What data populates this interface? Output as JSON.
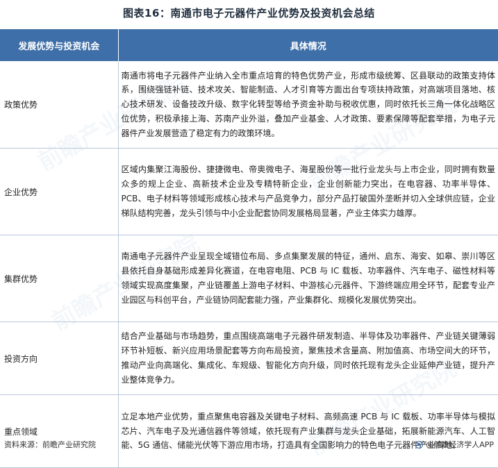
{
  "title": "图表16：南通市电子元器件产业优势及投资机会总结",
  "table": {
    "headers": [
      "发展优势与投资机会",
      "具体情况"
    ],
    "rows": [
      {
        "label": "政策优势",
        "text": "南通市将电子元器件产业纳入全市重点培育的特色优势产业，形成市级统筹、区县联动的政策支持体系，围绕强链补链、技术攻关、智能制造、人才引育等方面出台专项扶持政策，对高端项目落地、核心技术研发、设备技改升级、数字化转型等给予资金补助与税收优惠，同时依托长三角一体化战略区位优势，积极承接上海、苏南产业外溢，叠加产业基金、人才政策、要素保障等配套举措，为电子元器件产业发展营造了稳定有力的政策环境。"
      },
      {
        "label": "企业优势",
        "text": "区域内集聚江海股份、捷捷微电、帝奥微电子、海星股份等一批行业龙头与上市企业，同时拥有数量众多的规上企业、高新技术企业及专精特新企业，企业创新能力突出，在电容器、功率半导体、PCB、电子材料等领域形成核心技术与产品竞争力，部分产品打破国外垄断并切入全球供应链，企业梯队结构完善，龙头引领与中小企业配套协同发展格局显著，产业主体实力雄厚。"
      },
      {
        "label": "集群优势",
        "text": "南通电子元器件产业呈现全域错位布局、多点集聚发展的特征，通州、启东、海安、如皋、崇川等区县依托自身基础形成差异化赛道，在电容电阻、PCB 与 IC 载板、功率器件、汽车电子、磁性材料等领域实现高度集聚，产业链覆盖上游电子材料、中游核心元器件、下游终端应用全环节，配套专业产业园区与科创平台，产业链协同配套能力强，产业集群化、规模化发展优势突出。"
      },
      {
        "label": "投资方向",
        "text": "结合产业基础与市场趋势，重点围绕高端电子元器件研发制造、半导体及功率器件、产业链关键薄弱环节补短板、新兴应用场景配套等方向布局投资，聚焦技术含量高、附加值高、市场空间大的环节，推动产业向高端化、集成化、车规级、智能化方向升级，同时依托现有龙头企业延伸产业链，提升产业整体竞争力。"
      },
      {
        "label": "重点领域",
        "text": "立足本地产业优势，重点聚焦电容器及关键电子材料、高频高速 PCB 与 IC 载板、功率半导体与模拟芯片、汽车电子及光通信器件等领域，依托现有产业集群与龙头企业基础，拓展新能源汽车、人工智能、5G 通信、储能光伏等下游应用市场，打造具有全国影响力的特色电子元器件产业高地。"
      }
    ]
  },
  "footer": {
    "source": "资料来源：前瞻产业研究院",
    "brand": "@前瞻经济学人APP"
  },
  "watermark": "前瞻产业研究院",
  "colors": {
    "header_bg": "#3e6fa8",
    "border": "#b8c7d9"
  }
}
